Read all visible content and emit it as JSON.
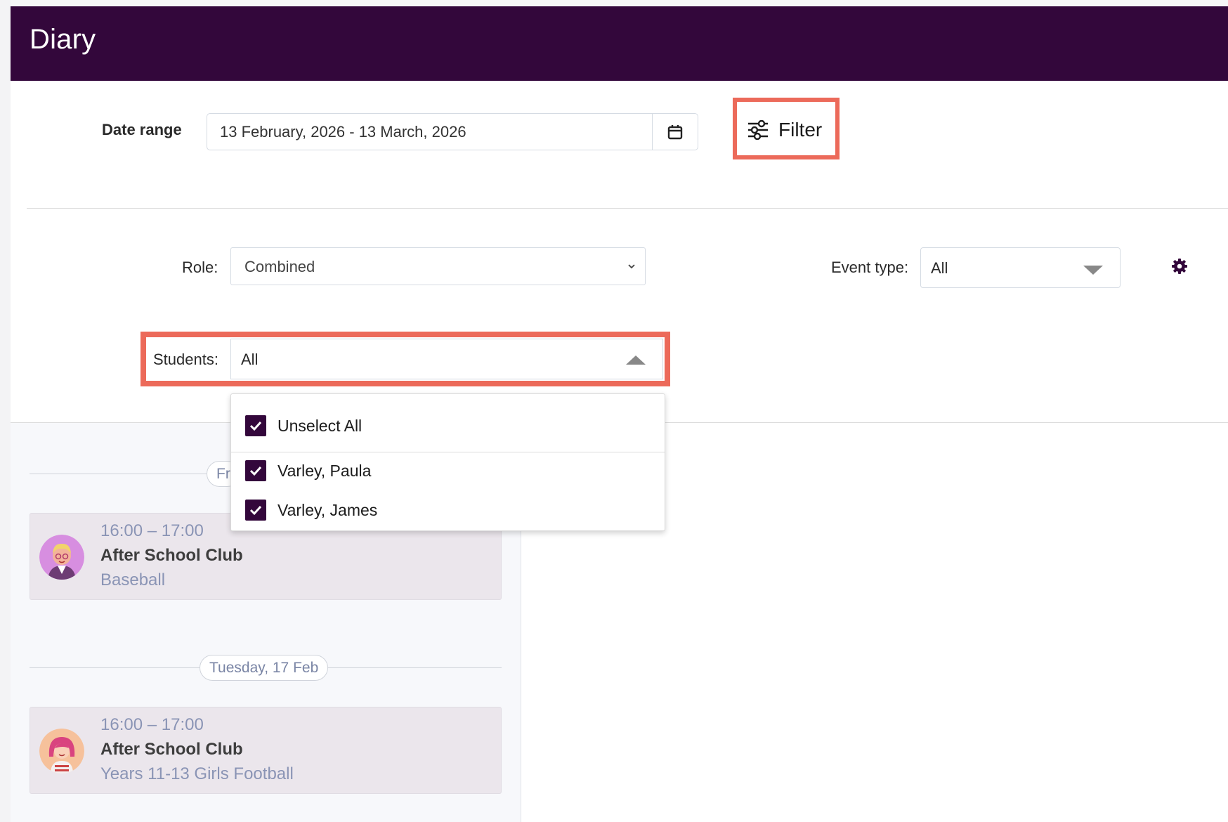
{
  "header": {
    "title": "Diary"
  },
  "date_range": {
    "label": "Date range",
    "value": "13 February, 2026 - 13 March, 2026",
    "calendar_icon": "calendar-icon"
  },
  "filter": {
    "label": "Filter",
    "icon": "sliders-icon"
  },
  "role": {
    "label": "Role:",
    "selected": "Combined"
  },
  "event_type": {
    "label": "Event type:",
    "selected": "All",
    "settings_icon": "gear-icon"
  },
  "students": {
    "label": "Students:",
    "selected": "All",
    "dropdown": {
      "unselect_all": {
        "label": "Unselect All",
        "checked": true
      },
      "options": [
        {
          "label": "Varley, Paula",
          "checked": true
        },
        {
          "label": "Varley, James",
          "checked": true
        }
      ]
    }
  },
  "diary": {
    "days": [
      {
        "label": "Fr",
        "events": [
          {
            "time": "16:00 – 17:00",
            "title": "After School Club",
            "subtitle": "Baseball",
            "avatar": "boy-avatar"
          }
        ]
      },
      {
        "label": "Tuesday, 17 Feb",
        "events": [
          {
            "time": "16:00 – 17:00",
            "title": "After School Club",
            "subtitle": "Years 11-13 Girls Football",
            "avatar": "girl-avatar"
          }
        ]
      }
    ]
  },
  "colors": {
    "brand": "#33073b",
    "highlight": "#ec6a5a",
    "event_card": "#ebe6ec",
    "muted_text": "#8a94b5"
  }
}
